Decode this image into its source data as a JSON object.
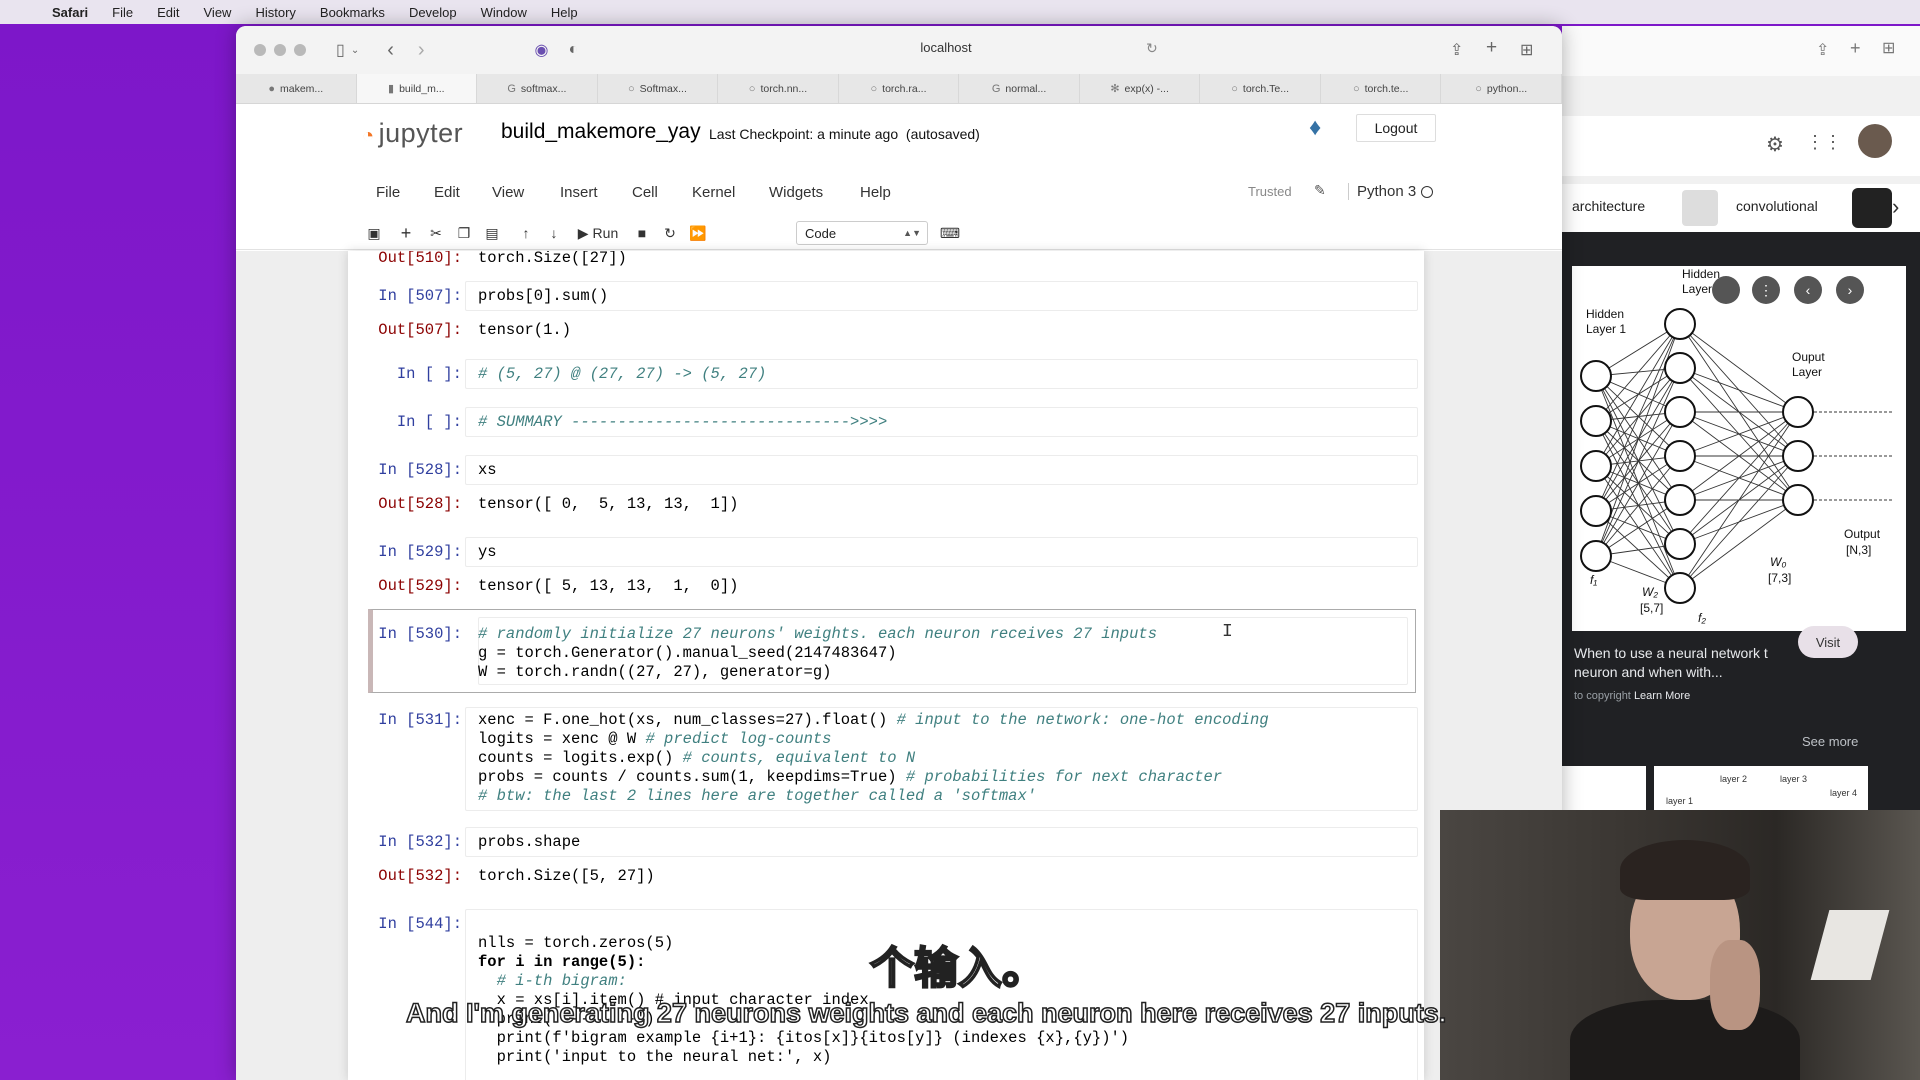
{
  "macos_menu": {
    "app": "Safari",
    "items": [
      "File",
      "Edit",
      "View",
      "History",
      "Bookmarks",
      "Develop",
      "Window",
      "Help"
    ]
  },
  "safari": {
    "address": "localhost",
    "tabs": [
      {
        "label": "makem...",
        "icon": "github-icon"
      },
      {
        "label": "build_m...",
        "icon": "jupyter-icon"
      },
      {
        "label": "softmax...",
        "icon": "google-icon"
      },
      {
        "label": "Softmax...",
        "icon": "link-icon"
      },
      {
        "label": "torch.nn...",
        "icon": "link-icon"
      },
      {
        "label": "torch.ra...",
        "icon": "link-icon"
      },
      {
        "label": "normal...",
        "icon": "google-icon"
      },
      {
        "label": "exp(x) -...",
        "icon": "gear-icon"
      },
      {
        "label": "torch.Te...",
        "icon": "link-icon"
      },
      {
        "label": "torch.te...",
        "icon": "link-icon"
      },
      {
        "label": "python...",
        "icon": "link-icon"
      }
    ]
  },
  "jupyter": {
    "logo": "jupyter",
    "notebook_name": "build_makemore_yay",
    "checkpoint": "Last Checkpoint: a minute ago",
    "autosave": "(autosaved)",
    "logout": "Logout",
    "menu": [
      "File",
      "Edit",
      "View",
      "Insert",
      "Cell",
      "Kernel",
      "Widgets",
      "Help"
    ],
    "trusted": "Trusted",
    "kernel": "Python 3",
    "run_label": "Run",
    "cell_type": "Code"
  },
  "cells": {
    "out510_prompt": "Out[510]:",
    "out510": "torch.Size([27])",
    "in507_prompt": "In [507]:",
    "in507": "probs[0].sum()",
    "out507_prompt": "Out[507]:",
    "out507": "tensor(1.)",
    "inblank1_prompt": "In [ ]:",
    "inblank1": "# (5, 27) @ (27, 27) -> (5, 27)",
    "inblank2_prompt": "In [ ]:",
    "inblank2": "# SUMMARY ------------------------------>>>>",
    "in528_prompt": "In [528]:",
    "in528": "xs",
    "out528_prompt": "Out[528]:",
    "out528": "tensor([ 0,  5, 13, 13,  1])",
    "in529_prompt": "In [529]:",
    "in529": "ys",
    "out529_prompt": "Out[529]:",
    "out529": "tensor([ 5, 13, 13,  1,  0])",
    "in530_prompt": "In [530]:",
    "in530_l1": "# randomly initialize 27 neurons' weights. each neuron receives 27 inputs",
    "in530_l2": "g = torch.Generator().manual_seed(2147483647)",
    "in530_l3": "W = torch.randn((27, 27), generator=g)",
    "in531_prompt": "In [531]:",
    "in531_l1a": "xenc = F.one_hot(xs, num_classes=27).float() ",
    "in531_l1b": "# input to the network: one-hot encoding",
    "in531_l2a": "logits = xenc @ W ",
    "in531_l2b": "# predict log-counts",
    "in531_l3a": "counts = logits.exp() ",
    "in531_l3b": "# counts, equivalent to N",
    "in531_l4a": "probs = counts / counts.sum(1, keepdims=True) ",
    "in531_l4b": "# probabilities for next character",
    "in531_l5": "# btw: the last 2 lines here are together called a 'softmax'",
    "in532_prompt": "In [532]:",
    "in532": "probs.shape",
    "out532_prompt": "Out[532]:",
    "out532": "torch.Size([5, 27])",
    "in544_prompt": "In [544]:",
    "in544_l1": "nlls = torch.zeros(5)",
    "in544_l2": "for i in range(5):",
    "in544_l3": "  # i-th bigram:",
    "in544_l4": "  x = xs[i].item() # input character index",
    "in544_l5": "  print('--------')",
    "in544_l6": "  print(f'bigram example {i+1}: {itos[x]}{itos[y]} (indexes {x},{y})')",
    "in544_l7": "  print('input to the neural net:', x)"
  },
  "right_panel": {
    "chip1": "architecture",
    "chip2": "convolutional",
    "diagram": {
      "hidden1": "Hidden Layer 1",
      "hidden2": "Hidden Layer",
      "output_layer": "Ouput Layer",
      "output": "Output [N,3]",
      "w2": "W2 [5,7]",
      "wo": "Wo [7,3]",
      "f1": "f1",
      "f2": "f2"
    },
    "caption": "When to use a neural network t neuron and when with...",
    "copyright": "to copyright",
    "learn_more": "Learn More",
    "visit": "Visit",
    "see_more": "See more",
    "thumb2_labels": [
      "layer 2",
      "layer 3",
      "layer 1",
      "layer 4"
    ]
  },
  "subtitles": {
    "chinese": "个输入。",
    "english": "And I'm generating 27 neurons weights and each neuron here receives 27 inputs."
  }
}
